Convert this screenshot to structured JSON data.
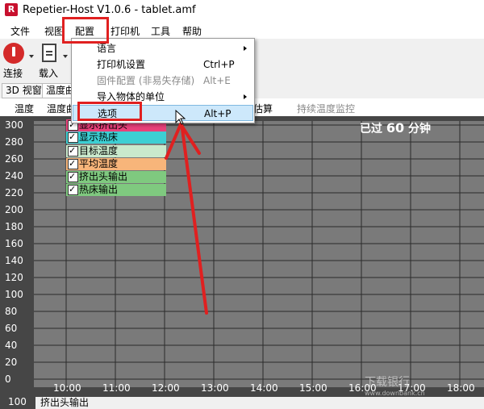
{
  "window": {
    "title": "Repetier-Host V1.0.6 - tablet.amf",
    "app_icon_letter": "R"
  },
  "menubar": [
    {
      "id": "file",
      "label": "文件"
    },
    {
      "id": "view",
      "label": "视图"
    },
    {
      "id": "config",
      "label": "配置"
    },
    {
      "id": "printer",
      "label": "打印机"
    },
    {
      "id": "tools",
      "label": "工具"
    },
    {
      "id": "help",
      "label": "帮助"
    }
  ],
  "toolbar": {
    "connect_label": "连接",
    "load_label": "载入"
  },
  "tabs": {
    "view3d": "3D 视窗",
    "temp_curve": "温度曲"
  },
  "subtabs": {
    "temperature": "温度",
    "temp_curve": "温度曲",
    "estimate": "估算",
    "continuous_monitor": "持续温度监控"
  },
  "dropdown": {
    "items": [
      {
        "label": "语言",
        "shortcut": "",
        "submenu": true,
        "disabled": false
      },
      {
        "label": "打印机设置",
        "shortcut": "Ctrl+P",
        "submenu": false,
        "disabled": false
      },
      {
        "label": "固件配置 (非易失存储)",
        "shortcut": "Alt+E",
        "submenu": false,
        "disabled": true
      },
      {
        "label": "导入物体的单位",
        "shortcut": "",
        "submenu": true,
        "disabled": false
      },
      {
        "label": "选项",
        "shortcut": "Alt+P",
        "submenu": false,
        "disabled": false,
        "highlighted": true
      }
    ]
  },
  "chart": {
    "y_ticks": [
      "300",
      "280",
      "260",
      "240",
      "220",
      "200",
      "180",
      "160",
      "140",
      "120",
      "100",
      "80",
      "60",
      "40",
      "20",
      "0"
    ],
    "x_ticks": [
      "10:00",
      "11:00",
      "12:00",
      "13:00",
      "14:00",
      "15:00",
      "16:00",
      "17:00",
      "18:00"
    ],
    "elapsed_prefix": "已过",
    "elapsed_value": "60",
    "elapsed_suffix": "分钟",
    "bottom_y_label": "100",
    "legend": [
      {
        "label": "显示挤出头",
        "color": "#e8417a"
      },
      {
        "label": "显示热床",
        "color": "#3ccfd3"
      },
      {
        "label": "目标温度",
        "color": "#c9e9cc"
      },
      {
        "label": "平均温度",
        "color": "#f7b57a"
      },
      {
        "label": "挤出头输出",
        "color": "#7fc97f"
      },
      {
        "label": "热床输出",
        "color": "#7fc97f"
      }
    ],
    "bottom_panel_label": "挤出头输出"
  },
  "watermark": {
    "text": "下载银行",
    "url": "www.downbank.cn"
  },
  "colors": {
    "annotation_red": "#e02020",
    "highlight": "#cde8fb"
  }
}
